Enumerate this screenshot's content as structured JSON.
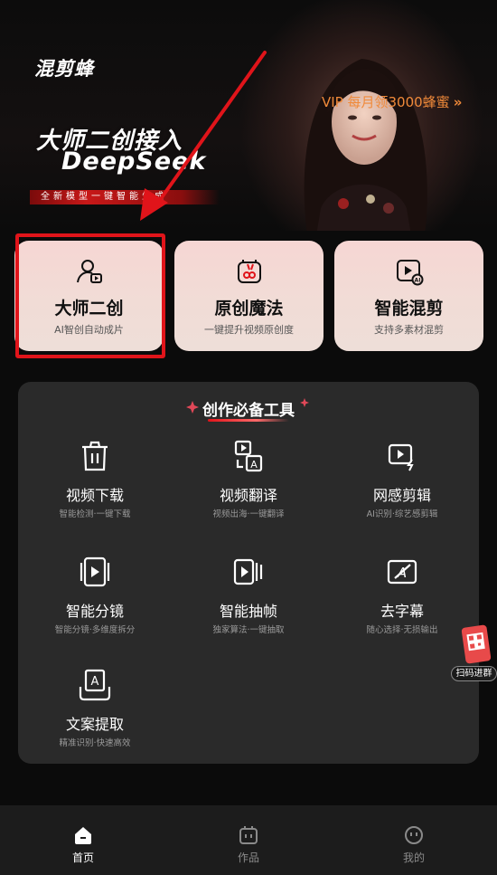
{
  "banner": {
    "brand": "混剪蜂",
    "vip_promo": "VIP 每月领3000蜂蜜",
    "vip_chevron": "»",
    "headline": "大师二创接入",
    "headline_en": "DeepSeek",
    "tagline": "全新模型一键智能生成"
  },
  "features": [
    {
      "title": "大师二创",
      "subtitle": "AI智创自动成片",
      "icon": "user-play-icon"
    },
    {
      "title": "原创魔法",
      "subtitle": "一键提升视频原创度",
      "icon": "magic-rabbit-icon"
    },
    {
      "title": "智能混剪",
      "subtitle": "支持多素材混剪",
      "icon": "ai-video-icon"
    }
  ],
  "tools_section": {
    "title": "创作必备工具",
    "items": [
      {
        "name": "视频下载",
        "desc": "智能检测·一键下载",
        "icon": "trash-download-icon"
      },
      {
        "name": "视频翻译",
        "desc": "视频出海·一键翻译",
        "icon": "translate-icon"
      },
      {
        "name": "网感剪辑",
        "desc": "AI识别·综艺感剪辑",
        "icon": "flash-video-icon"
      },
      {
        "name": "智能分镜",
        "desc": "智能分镜·多维度拆分",
        "icon": "storyboard-icon"
      },
      {
        "name": "智能抽帧",
        "desc": "独家算法·一键抽取",
        "icon": "frame-extract-icon"
      },
      {
        "name": "去字幕",
        "desc": "随心选择·无损输出",
        "icon": "remove-subtitle-icon"
      },
      {
        "name": "文案提取",
        "desc": "精准识别·快速高效",
        "icon": "text-extract-icon"
      }
    ]
  },
  "qr_float": {
    "label": "扫码进群"
  },
  "bottom_nav": [
    {
      "label": "首页",
      "icon": "home-icon",
      "active": true
    },
    {
      "label": "作品",
      "icon": "works-icon",
      "active": false
    },
    {
      "label": "我的",
      "icon": "profile-icon",
      "active": false
    }
  ],
  "colors": {
    "accent": "#e0141a",
    "vip": "#f08a3a",
    "card_bg": "#f4d8d4",
    "panel_bg": "#2a2a2a",
    "page_bg": "#0b0b0b"
  }
}
